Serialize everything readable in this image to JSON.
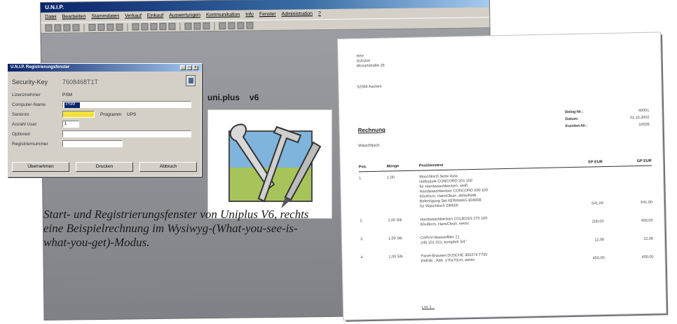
{
  "app": {
    "title": "U.N.I.P.",
    "menu": [
      "Datei",
      "Bearbeiten",
      "Stammdaten",
      "Verkauf",
      "Einkauf",
      "Auswertungen",
      "Kommunikation",
      "Info",
      "Fenster",
      "Administration",
      "?"
    ],
    "brand": "uni.plus",
    "version": "v6"
  },
  "dialog": {
    "title": "U.N.I.P. Registrierungsfenster",
    "security_label": "Security-Key",
    "security_value": "7608468T1T",
    "rows": [
      {
        "label": "Lizenznehmer",
        "value": "PSM"
      },
      {
        "label": "Computer-Name",
        "value": "PSM"
      },
      {
        "label": "Seriennr.",
        "value": "",
        "extra_label": "Programm",
        "extra_value": "UPS"
      },
      {
        "label": "Anzahl User",
        "value": "1"
      },
      {
        "label": "Optionen",
        "value": ""
      },
      {
        "label": "Registriernummer",
        "value": ""
      }
    ],
    "buttons": [
      "Übernehmen",
      "Drucken",
      "Abbruch"
    ]
  },
  "invoice": {
    "address": [
      "Herr",
      "Schulze",
      "Mozartstraße 26"
    ],
    "city": "52066 Aachen",
    "meta": [
      {
        "label": "Beleg-Nr.:",
        "value": "40001"
      },
      {
        "label": "Datum:",
        "value": "01.10.2002"
      },
      {
        "label": "Kunden-Nr.:",
        "value": "10026"
      }
    ],
    "heading": "Rechnung",
    "subject": "Waschtisch",
    "columns": [
      "Pos.",
      "Menge",
      "Positionstext",
      "EP EUR",
      "GP EUR"
    ],
    "items": [
      {
        "pos": "1.",
        "menge": "1,00",
        "lines": [
          "Waschtisch Serie Auta",
          "Halbsäule CONCORD 201 100",
          "für Handwaschbecken, weiß",
          "Handwaschbecken CONCORD 200 100",
          "60x40cm, HansClean, ablaufsieb",
          "Befestigung Set KERAMAG 604008",
          "für Waschtisch 2W600"
        ],
        "ep": "541,00",
        "gp": "541,00"
      },
      {
        "pos": "2.",
        "menge": "2,00 Stk",
        "lines": [
          "Handwaschbecken COLBOSS 270 100",
          "60x46cm, HansClean, weiss"
        ],
        "ep": "200,00",
        "gp": "400,00"
      },
      {
        "pos": "3.",
        "menge": "1,00 Stk",
        "lines": [
          "CeRoV-Wasserfilter 21",
          "245 101 021, komplett 3/4\""
        ],
        "ep": "12,06",
        "gp": "12,06"
      },
      {
        "pos": "4.",
        "menge": "1,00 Stk",
        "lines": [
          "Panel-Brausen DUSCHE 300274 T700",
          "EMISE , Abh. 170x70cm, weiss"
        ],
        "ep": "450,00",
        "gp": "450,00"
      }
    ],
    "footer": "Los 1..."
  },
  "caption": "Start- und Registrierungsfenster von Uniplus V6, rechts eine Beispielrechnung im Wysiwyg-(What-you-see-is-what-you-get)-Modus."
}
